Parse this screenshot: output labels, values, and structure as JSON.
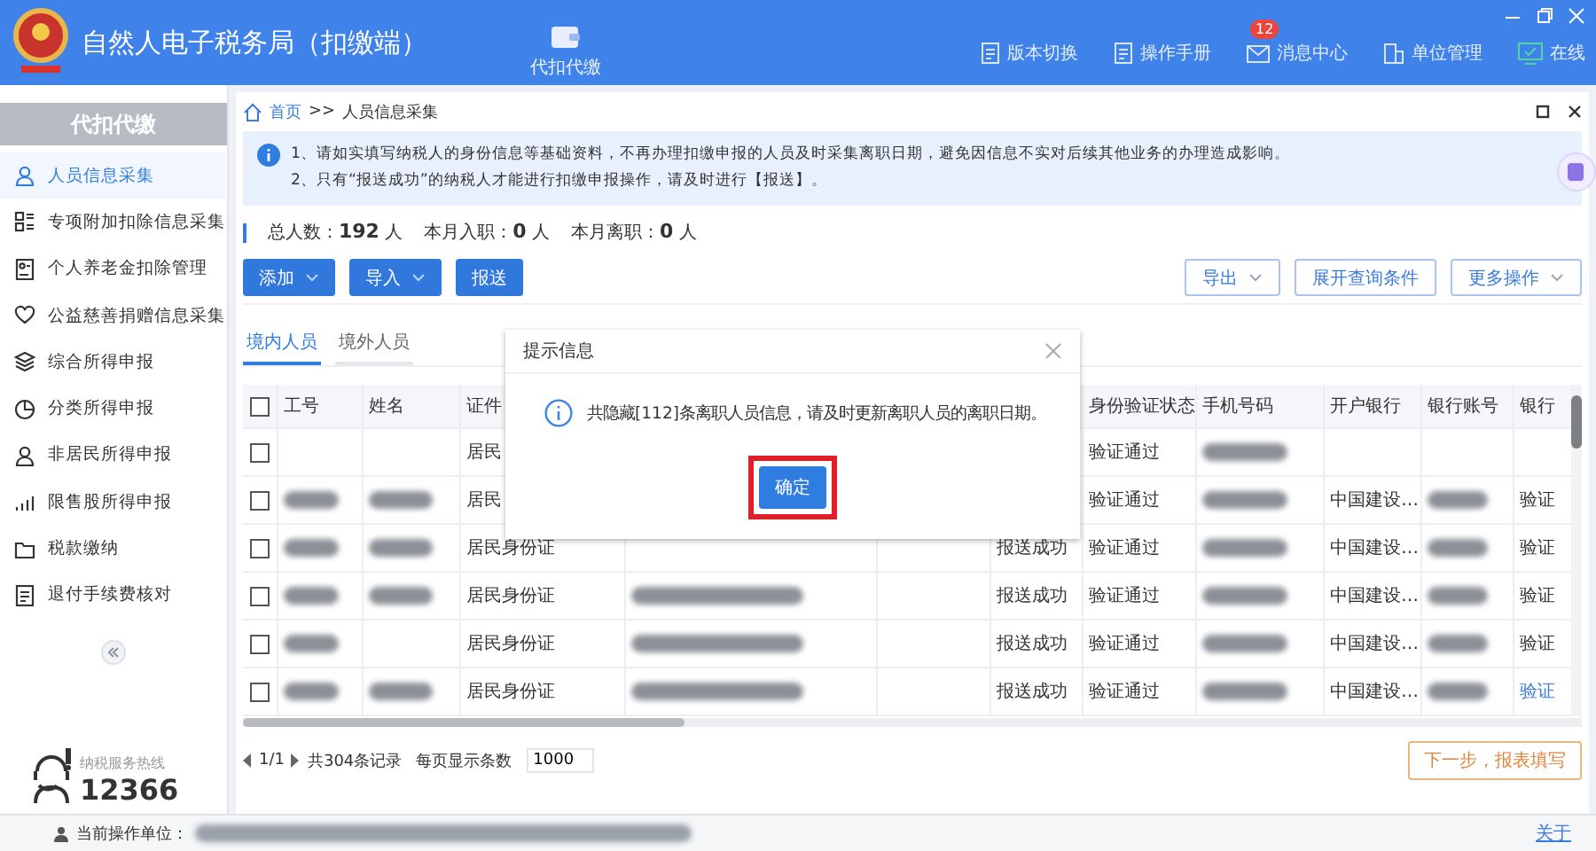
{
  "window": {
    "title": "自然人电子税务局（扣缴端）"
  },
  "header": {
    "module": {
      "label": "代扣代缴"
    },
    "actions": [
      {
        "label": "版本切换"
      },
      {
        "label": "操作手册"
      },
      {
        "label": "消息中心",
        "badge": "12"
      },
      {
        "label": "单位管理"
      },
      {
        "label": "在线"
      }
    ]
  },
  "sidebar": {
    "title": "代扣代缴",
    "items": [
      {
        "label": "人员信息采集",
        "selected": true
      },
      {
        "label": "专项附加扣除信息采集",
        "selected": false
      },
      {
        "label": "个人养老金扣除管理",
        "selected": false
      },
      {
        "label": "公益慈善捐赠信息采集",
        "selected": false
      },
      {
        "label": "综合所得申报",
        "selected": false
      },
      {
        "label": "分类所得申报",
        "selected": false
      },
      {
        "label": "非居民所得申报",
        "selected": false
      },
      {
        "label": "限售股所得申报",
        "selected": false
      },
      {
        "label": "税款缴纳",
        "selected": false
      },
      {
        "label": "退付手续费核对",
        "selected": false
      }
    ],
    "hotline": {
      "label": "纳税服务热线",
      "number": "12366"
    }
  },
  "breadcrumb": {
    "home": "首页",
    "separator": ">>",
    "current": "人员信息采集"
  },
  "notice": {
    "lines": [
      "1、请如实填写纳税人的身份信息等基础资料，不再办理扣缴申报的人员及时采集离职日期，避免因信息不实对后续其他业务的办理造成影响。",
      "2、只有“报送成功”的纳税人才能进行扣缴申报操作，请及时进行【报送】。"
    ]
  },
  "stats": [
    {
      "label": "总人数：",
      "value": "192",
      "unit": "人"
    },
    {
      "label": "本月入职：",
      "value": "0",
      "unit": "人"
    },
    {
      "label": "本月离职：",
      "value": "0",
      "unit": "人"
    }
  ],
  "toolbar": {
    "left": [
      {
        "label": "添加",
        "dropdown": true
      },
      {
        "label": "导入",
        "dropdown": true
      },
      {
        "label": "报送",
        "dropdown": false
      }
    ],
    "right": [
      {
        "label": "导出",
        "dropdown": true
      },
      {
        "label": "展开查询条件",
        "dropdown": false
      },
      {
        "label": "更多操作",
        "dropdown": true
      }
    ]
  },
  "tabs": [
    {
      "label": "境内人员",
      "selected": true
    },
    {
      "label": "境外人员",
      "selected": false
    }
  ],
  "table": {
    "select_all": {
      "checked": false
    },
    "columns": [
      {
        "label": "工号"
      },
      {
        "label": "姓名"
      },
      {
        "label": "证件"
      },
      {},
      {},
      {},
      {
        "label": "身份验证状态"
      },
      {
        "label": "手机号码"
      },
      {
        "label": "开户银行"
      },
      {
        "label": "银行账号"
      },
      {
        "label": "银行"
      }
    ],
    "rows": [
      {
        "checked": false,
        "cells": [
          {
            "kind": "blank"
          },
          {
            "kind": "blank"
          },
          {
            "kind": "text",
            "text": "居民"
          },
          {
            "kind": "blank"
          },
          {
            "kind": "blank"
          },
          {
            "kind": "blank"
          },
          {
            "kind": "text",
            "text": "验证通过"
          },
          {
            "kind": "redacted"
          },
          {
            "kind": "blank"
          },
          {
            "kind": "blank"
          },
          {
            "kind": "blank"
          }
        ]
      },
      {
        "checked": false,
        "cells": [
          {
            "kind": "redacted"
          },
          {
            "kind": "redacted"
          },
          {
            "kind": "text",
            "text": "居民"
          },
          {
            "kind": "blank"
          },
          {
            "kind": "blank"
          },
          {
            "kind": "blank"
          },
          {
            "kind": "text",
            "text": "验证通过"
          },
          {
            "kind": "redacted"
          },
          {
            "kind": "text",
            "text": "中国建设…"
          },
          {
            "kind": "redacted"
          },
          {
            "kind": "text",
            "text": "验证"
          }
        ]
      },
      {
        "checked": false,
        "cells": [
          {
            "kind": "redacted"
          },
          {
            "kind": "redacted"
          },
          {
            "kind": "text",
            "text": "居民身份证"
          },
          {
            "kind": "blank"
          },
          {
            "kind": "blank"
          },
          {
            "kind": "text",
            "text": "报送成功"
          },
          {
            "kind": "text",
            "text": "验证通过"
          },
          {
            "kind": "redacted"
          },
          {
            "kind": "text",
            "text": "中国建设…"
          },
          {
            "kind": "redacted"
          },
          {
            "kind": "text",
            "text": "验证"
          }
        ]
      },
      {
        "checked": false,
        "cells": [
          {
            "kind": "redacted"
          },
          {
            "kind": "redacted"
          },
          {
            "kind": "text",
            "text": "居民身份证"
          },
          {
            "kind": "redacted"
          },
          {
            "kind": "blank"
          },
          {
            "kind": "text",
            "text": "报送成功"
          },
          {
            "kind": "text",
            "text": "验证通过"
          },
          {
            "kind": "redacted"
          },
          {
            "kind": "text",
            "text": "中国建设…"
          },
          {
            "kind": "redacted"
          },
          {
            "kind": "text",
            "text": "验证"
          }
        ]
      },
      {
        "checked": false,
        "cells": [
          {
            "kind": "redacted"
          },
          {
            "kind": "blank"
          },
          {
            "kind": "text",
            "text": "居民身份证"
          },
          {
            "kind": "redacted"
          },
          {
            "kind": "blank"
          },
          {
            "kind": "text",
            "text": "报送成功"
          },
          {
            "kind": "text",
            "text": "验证通过"
          },
          {
            "kind": "redacted"
          },
          {
            "kind": "text",
            "text": "中国建设…"
          },
          {
            "kind": "redacted"
          },
          {
            "kind": "text",
            "text": "验证"
          }
        ]
      },
      {
        "checked": false,
        "cells": [
          {
            "kind": "redacted"
          },
          {
            "kind": "redacted"
          },
          {
            "kind": "text",
            "text": "居民身份证"
          },
          {
            "kind": "redacted"
          },
          {
            "kind": "blank"
          },
          {
            "kind": "text",
            "text": "报送成功"
          },
          {
            "kind": "text",
            "text": "验证通过"
          },
          {
            "kind": "redacted"
          },
          {
            "kind": "text",
            "text": "中国建设…"
          },
          {
            "kind": "redacted"
          },
          {
            "kind": "link",
            "text": "验证"
          }
        ]
      }
    ]
  },
  "pagination": {
    "page": "1/1",
    "total": "共304条记录",
    "page_size_label": "每页显示条数",
    "page_size": "1000"
  },
  "next_button": {
    "label": "下一步，报表填写"
  },
  "status_bar": {
    "unit_label": "当前操作单位：",
    "about": "关于"
  },
  "dialog": {
    "title": "提示信息",
    "message": "共隐藏[112]条离职人员信息，请及时更新离职人员的离职日期。",
    "confirm": "确定",
    "highlighted": true
  }
}
